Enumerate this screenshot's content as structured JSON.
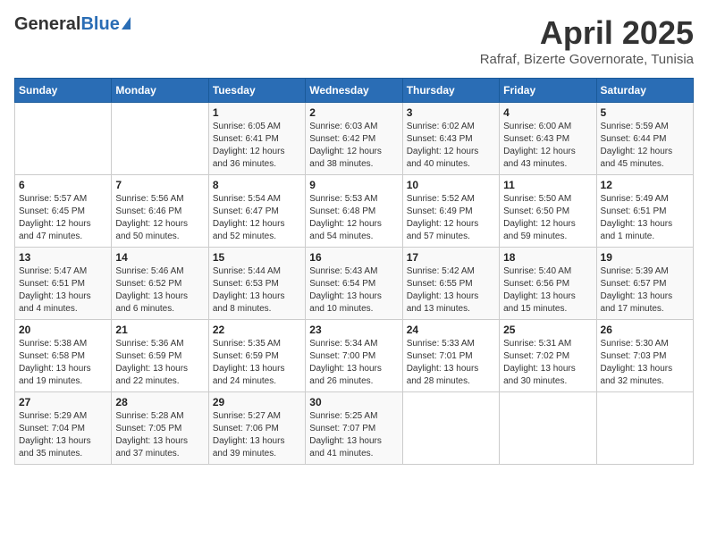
{
  "header": {
    "logo_general": "General",
    "logo_blue": "Blue",
    "month_title": "April 2025",
    "subtitle": "Rafraf, Bizerte Governorate, Tunisia"
  },
  "weekdays": [
    "Sunday",
    "Monday",
    "Tuesday",
    "Wednesday",
    "Thursday",
    "Friday",
    "Saturday"
  ],
  "weeks": [
    [
      {
        "day": "",
        "info": ""
      },
      {
        "day": "",
        "info": ""
      },
      {
        "day": "1",
        "info": "Sunrise: 6:05 AM\nSunset: 6:41 PM\nDaylight: 12 hours\nand 36 minutes."
      },
      {
        "day": "2",
        "info": "Sunrise: 6:03 AM\nSunset: 6:42 PM\nDaylight: 12 hours\nand 38 minutes."
      },
      {
        "day": "3",
        "info": "Sunrise: 6:02 AM\nSunset: 6:43 PM\nDaylight: 12 hours\nand 40 minutes."
      },
      {
        "day": "4",
        "info": "Sunrise: 6:00 AM\nSunset: 6:43 PM\nDaylight: 12 hours\nand 43 minutes."
      },
      {
        "day": "5",
        "info": "Sunrise: 5:59 AM\nSunset: 6:44 PM\nDaylight: 12 hours\nand 45 minutes."
      }
    ],
    [
      {
        "day": "6",
        "info": "Sunrise: 5:57 AM\nSunset: 6:45 PM\nDaylight: 12 hours\nand 47 minutes."
      },
      {
        "day": "7",
        "info": "Sunrise: 5:56 AM\nSunset: 6:46 PM\nDaylight: 12 hours\nand 50 minutes."
      },
      {
        "day": "8",
        "info": "Sunrise: 5:54 AM\nSunset: 6:47 PM\nDaylight: 12 hours\nand 52 minutes."
      },
      {
        "day": "9",
        "info": "Sunrise: 5:53 AM\nSunset: 6:48 PM\nDaylight: 12 hours\nand 54 minutes."
      },
      {
        "day": "10",
        "info": "Sunrise: 5:52 AM\nSunset: 6:49 PM\nDaylight: 12 hours\nand 57 minutes."
      },
      {
        "day": "11",
        "info": "Sunrise: 5:50 AM\nSunset: 6:50 PM\nDaylight: 12 hours\nand 59 minutes."
      },
      {
        "day": "12",
        "info": "Sunrise: 5:49 AM\nSunset: 6:51 PM\nDaylight: 13 hours\nand 1 minute."
      }
    ],
    [
      {
        "day": "13",
        "info": "Sunrise: 5:47 AM\nSunset: 6:51 PM\nDaylight: 13 hours\nand 4 minutes."
      },
      {
        "day": "14",
        "info": "Sunrise: 5:46 AM\nSunset: 6:52 PM\nDaylight: 13 hours\nand 6 minutes."
      },
      {
        "day": "15",
        "info": "Sunrise: 5:44 AM\nSunset: 6:53 PM\nDaylight: 13 hours\nand 8 minutes."
      },
      {
        "day": "16",
        "info": "Sunrise: 5:43 AM\nSunset: 6:54 PM\nDaylight: 13 hours\nand 10 minutes."
      },
      {
        "day": "17",
        "info": "Sunrise: 5:42 AM\nSunset: 6:55 PM\nDaylight: 13 hours\nand 13 minutes."
      },
      {
        "day": "18",
        "info": "Sunrise: 5:40 AM\nSunset: 6:56 PM\nDaylight: 13 hours\nand 15 minutes."
      },
      {
        "day": "19",
        "info": "Sunrise: 5:39 AM\nSunset: 6:57 PM\nDaylight: 13 hours\nand 17 minutes."
      }
    ],
    [
      {
        "day": "20",
        "info": "Sunrise: 5:38 AM\nSunset: 6:58 PM\nDaylight: 13 hours\nand 19 minutes."
      },
      {
        "day": "21",
        "info": "Sunrise: 5:36 AM\nSunset: 6:59 PM\nDaylight: 13 hours\nand 22 minutes."
      },
      {
        "day": "22",
        "info": "Sunrise: 5:35 AM\nSunset: 6:59 PM\nDaylight: 13 hours\nand 24 minutes."
      },
      {
        "day": "23",
        "info": "Sunrise: 5:34 AM\nSunset: 7:00 PM\nDaylight: 13 hours\nand 26 minutes."
      },
      {
        "day": "24",
        "info": "Sunrise: 5:33 AM\nSunset: 7:01 PM\nDaylight: 13 hours\nand 28 minutes."
      },
      {
        "day": "25",
        "info": "Sunrise: 5:31 AM\nSunset: 7:02 PM\nDaylight: 13 hours\nand 30 minutes."
      },
      {
        "day": "26",
        "info": "Sunrise: 5:30 AM\nSunset: 7:03 PM\nDaylight: 13 hours\nand 32 minutes."
      }
    ],
    [
      {
        "day": "27",
        "info": "Sunrise: 5:29 AM\nSunset: 7:04 PM\nDaylight: 13 hours\nand 35 minutes."
      },
      {
        "day": "28",
        "info": "Sunrise: 5:28 AM\nSunset: 7:05 PM\nDaylight: 13 hours\nand 37 minutes."
      },
      {
        "day": "29",
        "info": "Sunrise: 5:27 AM\nSunset: 7:06 PM\nDaylight: 13 hours\nand 39 minutes."
      },
      {
        "day": "30",
        "info": "Sunrise: 5:25 AM\nSunset: 7:07 PM\nDaylight: 13 hours\nand 41 minutes."
      },
      {
        "day": "",
        "info": ""
      },
      {
        "day": "",
        "info": ""
      },
      {
        "day": "",
        "info": ""
      }
    ]
  ]
}
